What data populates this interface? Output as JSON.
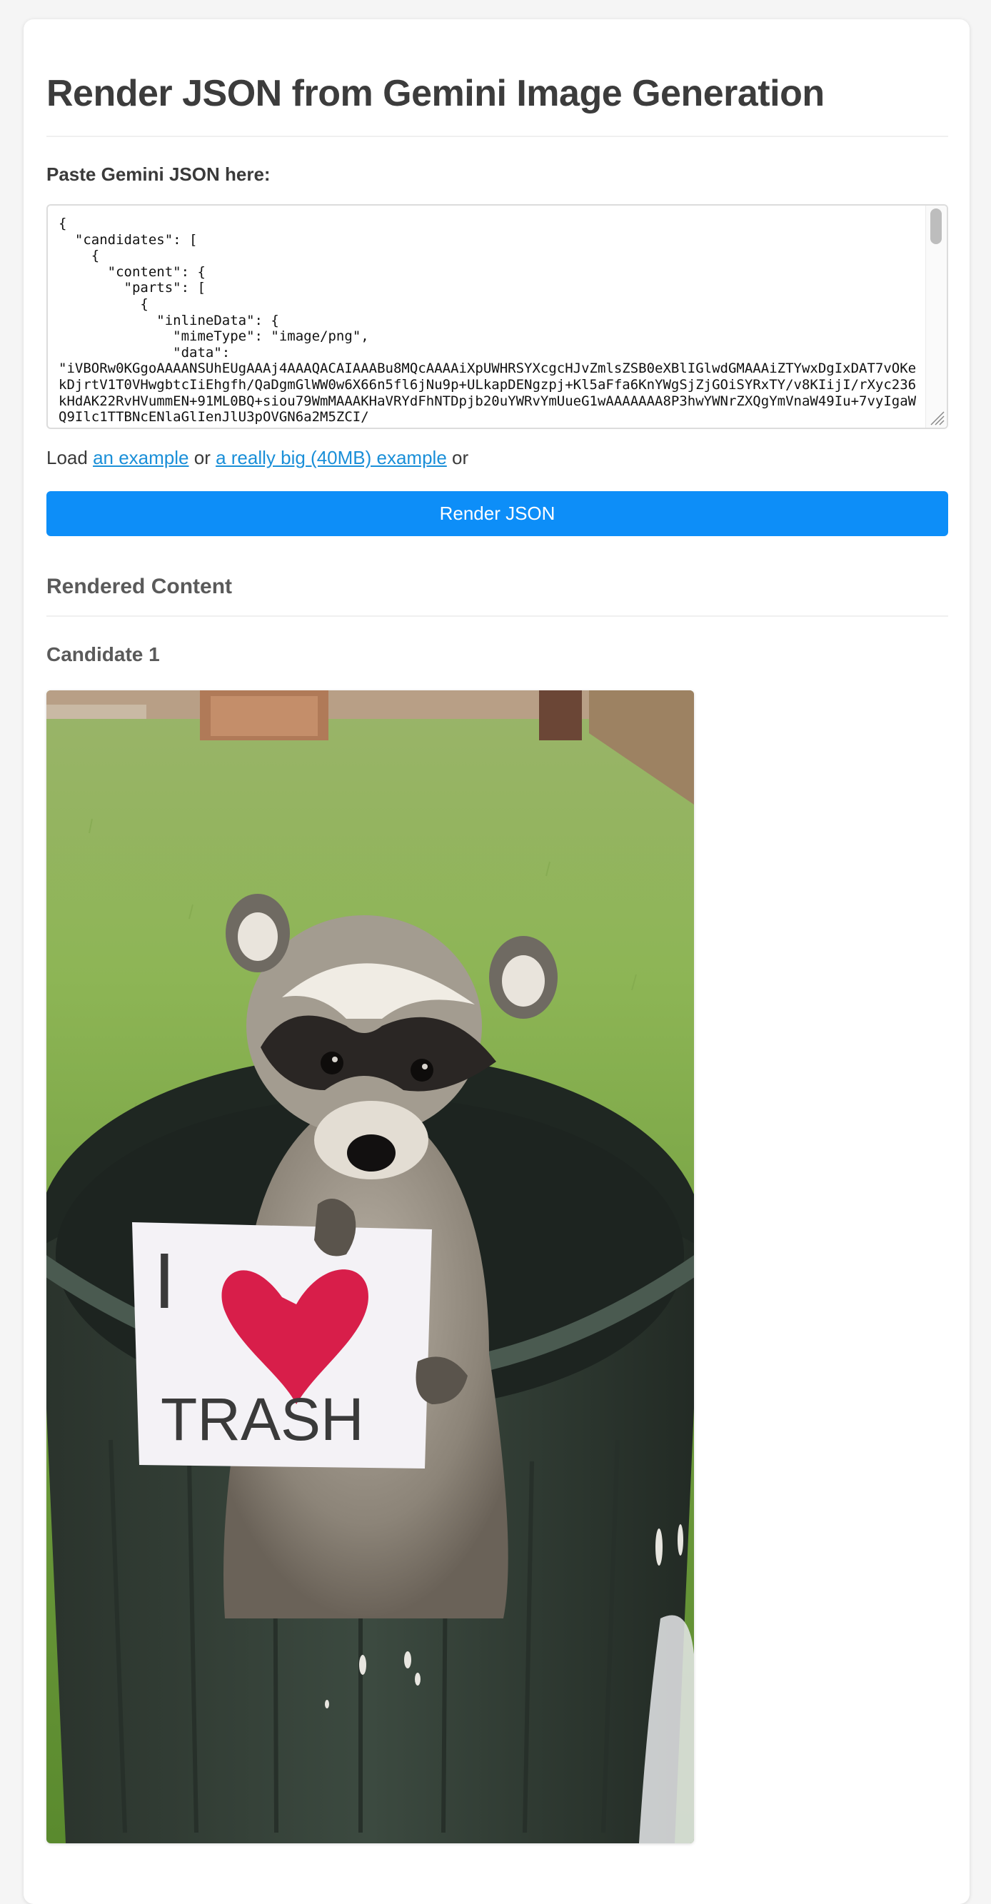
{
  "page": {
    "title": "Render JSON from Gemini Image Generation"
  },
  "input": {
    "label": "Paste Gemini JSON here:",
    "value": "{\n  \"candidates\": [\n    {\n      \"content\": {\n        \"parts\": [\n          {\n            \"inlineData\": {\n              \"mimeType\": \"image/png\",\n              \"data\":\n\"iVBORw0KGgoAAAANSUhEUgAAAj4AAAQACAIAAABu8MQcAAAAiXpUWHRSYXcgcHJvZmlsZSB0eXBlIGlwdGMAAAiZTYwxDgIxDAT7vOKekDjrtV1T0VHwgbtcIiEhgfh/QaDgmGlWW0w6X66n5fl6jNu9p+ULkapDENgzpj+Kl5aFfa6KnYWgSjZjGOiSYRxTY/v8KIijI/rXyc236kHdAK22RvHVummEN+91ML0BQ+siou79WmMAAAKHaVRYdFhNTDpjb20uYWRvYmUueG1wAAAAAAA8P3hwYWNrZXQgYmVnaW49Iu+7vyIgaWQ9Ilc1TTBNcENlaGlIenJlU3pOVGN6a2M5ZCI/\n"
  },
  "load_line": {
    "prefix": "Load",
    "example_link": "an example",
    "middle": "or",
    "big_example_link": "a really big (40MB) example",
    "suffix": "or"
  },
  "render_button": {
    "label": "Render JSON",
    "color": "#0d8ef8"
  },
  "output": {
    "section_title": "Rendered Content",
    "candidates": [
      {
        "title": "Candidate 1",
        "sign_text": "TRASH",
        "sign_letter": "I"
      }
    ]
  },
  "colors": {
    "link": "#1a8fd8",
    "page_background": "#f5f5f5"
  }
}
